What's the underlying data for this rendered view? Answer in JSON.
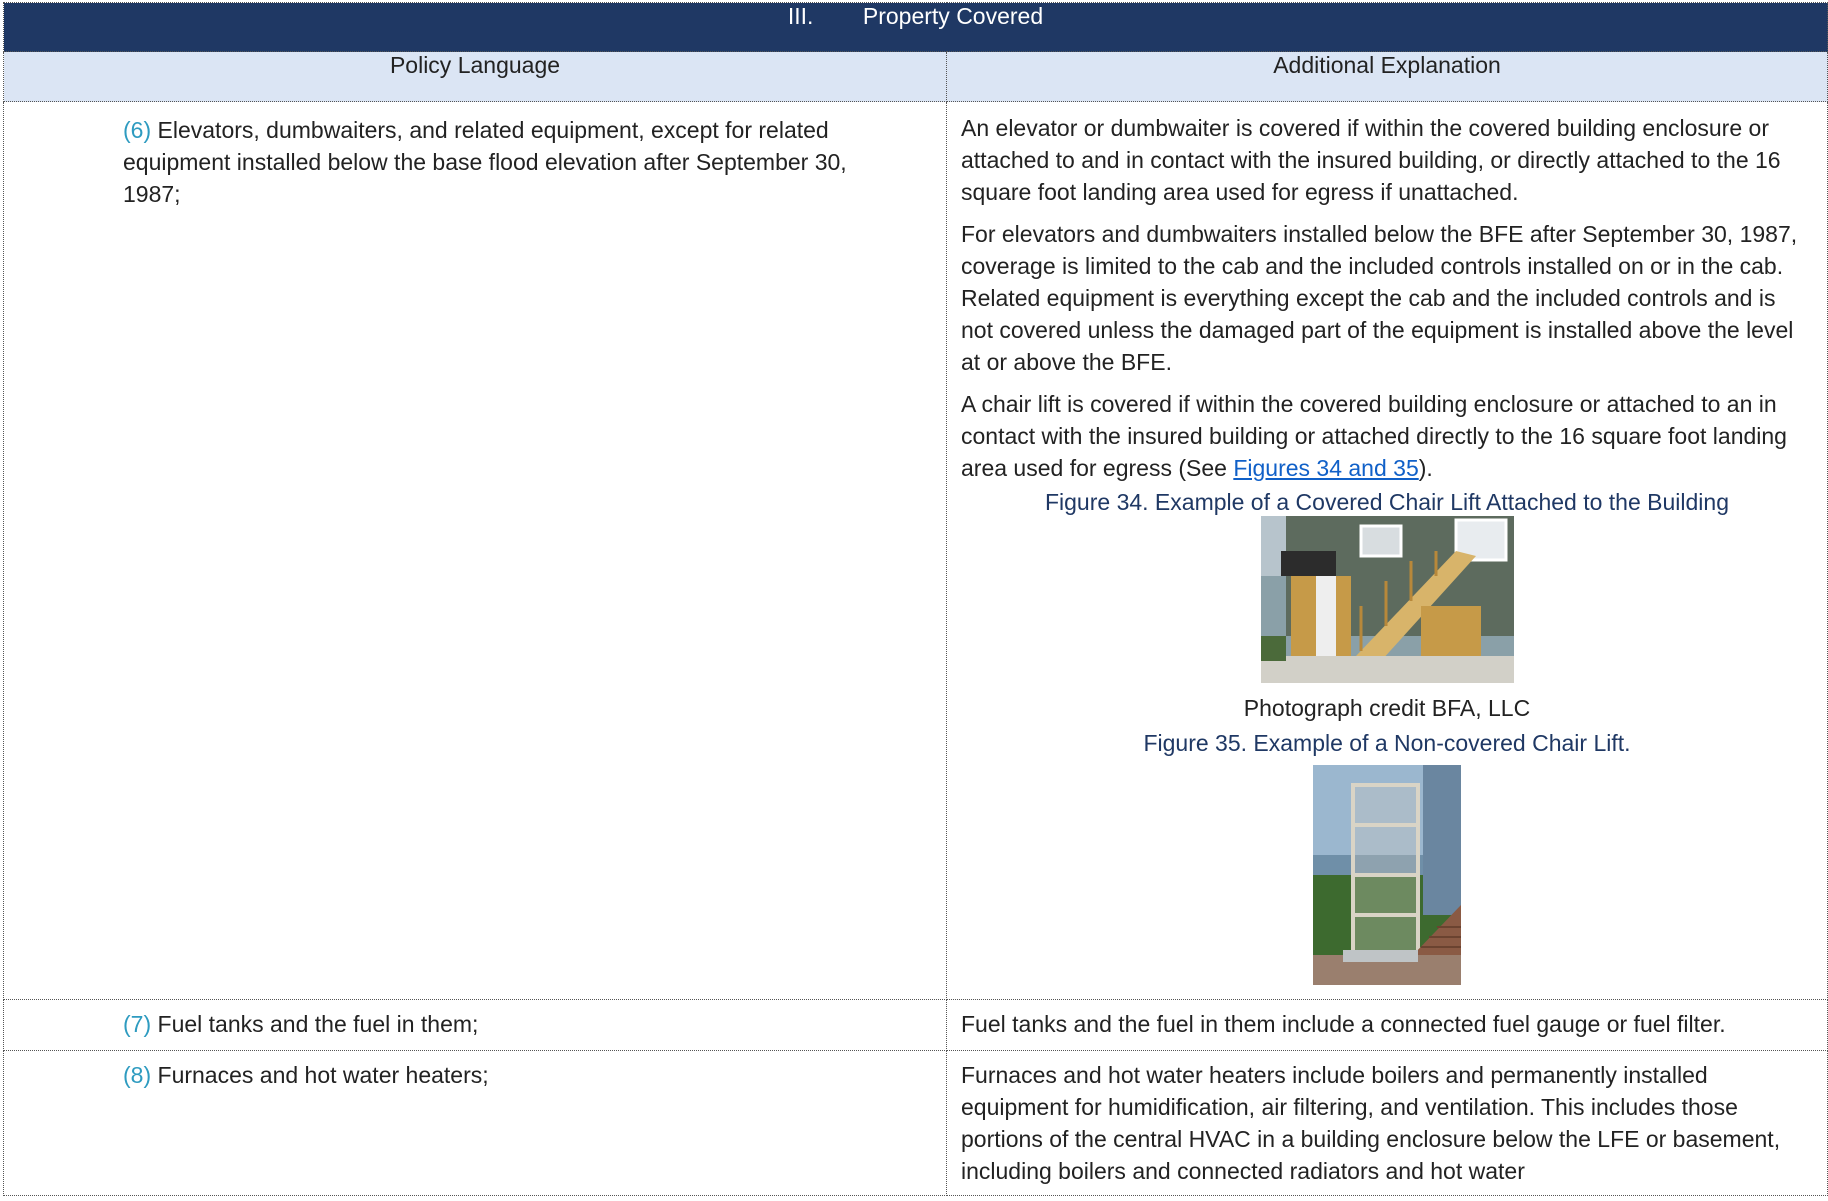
{
  "header": {
    "section_number": "III.",
    "section_title": "Property Covered"
  },
  "columns": {
    "left": "Policy Language",
    "right": "Additional Explanation"
  },
  "rows": [
    {
      "marker": "(6)",
      "policy": "Elevators, dumbwaiters, and related equipment, except for related equipment installed below the base flood elevation after September 30, 1987;",
      "p1": "An elevator or dumbwaiter is covered if within the covered building enclosure or attached to and in contact with the insured building, or directly attached to the 16 square foot landing area used for egress if unattached.",
      "p2": "For elevators and dumbwaiters installed below the BFE after September 30, 1987, coverage is limited to the cab and the included controls installed on or in the cab. Related equipment is everything except the cab and the included controls and is not covered unless the damaged part of the equipment is installed above the level at or above the BFE.",
      "p3_before": "A chair lift is covered if within the covered building enclosure or attached to an in contact with the insured building or attached directly to the 16 square foot landing area used for egress (See ",
      "p3_link": "Figures 34 and 35",
      "p3_after": ").",
      "fig34_caption": "Figure 34. Example of a Covered Chair Lift Attached to the Building",
      "fig34_credit": "Photograph credit BFA, LLC",
      "fig35_caption": "Figure 35. Example of a Non-covered Chair Lift."
    },
    {
      "marker": "(7)",
      "policy": "Fuel tanks and the fuel in them;",
      "explanation": "Fuel tanks and the fuel in them include a connected fuel gauge or fuel filter."
    },
    {
      "marker": "(8)",
      "policy": "Furnaces and hot water heaters;",
      "explanation": "Furnaces and hot water heaters include boilers and permanently installed equipment for humidification, air filtering, and ventilation. This includes those portions of the central HVAC in a building enclosure below the LFE or basement, including boilers and connected radiators and hot water"
    }
  ],
  "colors": {
    "title_bar": "#1f3864",
    "header_bg": "#dbe5f4",
    "marker": "#2e9bc0",
    "link": "#1060c8"
  }
}
